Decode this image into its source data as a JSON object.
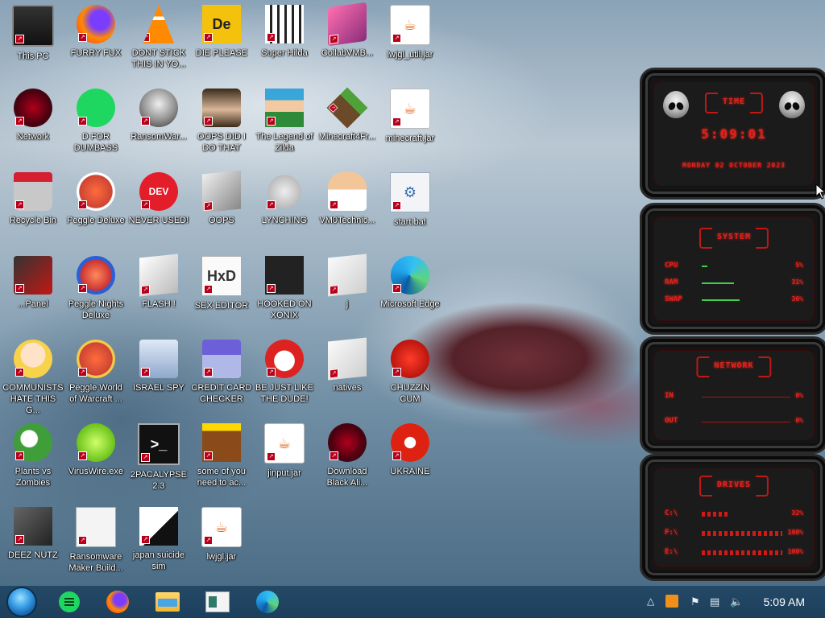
{
  "desktop": {
    "icons": [
      {
        "label": "This PC",
        "icon": "computer-icon"
      },
      {
        "label": "FURRY FUX",
        "icon": "firefox-icon"
      },
      {
        "label": "DONT STICK THIS IN YO...",
        "icon": "vlc-cone-icon"
      },
      {
        "label": "DIE PLEASE",
        "icon": "die-logo-icon"
      },
      {
        "label": "Super Hilda",
        "icon": "pixel-art-icon"
      },
      {
        "label": "CollabVMB...",
        "icon": "collabvm-icon"
      },
      {
        "label": "lwjgl_util.jar",
        "icon": "java-jar-icon"
      },
      {
        "label": "Network",
        "icon": "network-icon"
      },
      {
        "label": "D FOR DUMBASS",
        "icon": "green-chat-icon"
      },
      {
        "label": "RansomWar...",
        "icon": "skull-icon"
      },
      {
        "label": "OOPS DID I DO THAT",
        "icon": "portrait-icon"
      },
      {
        "label": "The Legend of Zilda",
        "icon": "pixel-hero-icon"
      },
      {
        "label": "Minecraft4Fr...",
        "icon": "grass-block-icon"
      },
      {
        "label": "minecraft.jar",
        "icon": "java-jar-icon"
      },
      {
        "label": "Recycle Bin",
        "icon": "recycle-bin-icon"
      },
      {
        "label": "Peggle Deluxe",
        "icon": "peggle-icon"
      },
      {
        "label": "NEVER USED!",
        "icon": "devcpp-icon"
      },
      {
        "label": "OOPS",
        "icon": "oops-box-icon"
      },
      {
        "label": "LYNCHING",
        "icon": "noose-icon"
      },
      {
        "label": "VM0Technic...",
        "icon": "doctor-icon"
      },
      {
        "label": "start.bat",
        "icon": "batch-file-icon"
      },
      {
        "label": "...Panel",
        "icon": "control-panel-icon"
      },
      {
        "label": "Peggle Nights Deluxe",
        "icon": "peggle-nights-icon"
      },
      {
        "label": "FLASH !",
        "icon": "flash-icon"
      },
      {
        "label": "SEX EDITOR",
        "icon": "hxd-icon"
      },
      {
        "label": "HOOKED ON XONIX",
        "icon": "xonix-icon"
      },
      {
        "label": "j",
        "icon": "file-icon"
      },
      {
        "label": "Microsoft Edge",
        "icon": "edge-icon"
      },
      {
        "label": "COMMUNISTS HATE THIS G...",
        "icon": "cartoon-girl-icon"
      },
      {
        "label": "Peggle World of Warcraft ...",
        "icon": "peggle-wow-icon"
      },
      {
        "label": "ISRAEL SPY",
        "icon": "spy-icon"
      },
      {
        "label": "CREDIT CARD CHECKER",
        "icon": "credit-card-icon"
      },
      {
        "label": "BE JUST LIKE THE DUDE!",
        "icon": "santa-icon"
      },
      {
        "label": "natives",
        "icon": "folder-file-icon"
      },
      {
        "label": "CHUZZIN CUM",
        "icon": "chuzzle-icon"
      },
      {
        "label": "Plants vs Zombies",
        "icon": "plant-icon"
      },
      {
        "label": "VirusWire.exe",
        "icon": "lime-icon"
      },
      {
        "label": "2PACALYPSE 2.3",
        "icon": "terminal-icon"
      },
      {
        "label": "some of you need to ac...",
        "icon": "dog-icon"
      },
      {
        "label": "jinput.jar",
        "icon": "java-jar-icon"
      },
      {
        "label": "Download Black Ali...",
        "icon": "alienware-icon"
      },
      {
        "label": "UKRAINE",
        "icon": "radiation-icon"
      },
      {
        "label": "DEEZ NUTZ",
        "icon": "stack-icon"
      },
      {
        "label": "Ransomware Maker Build...",
        "icon": "window-app-icon"
      },
      {
        "label": "japan suicide sim",
        "icon": "anime-sim-icon"
      },
      {
        "label": "lwjgl.jar",
        "icon": "java-jar-icon"
      }
    ]
  },
  "widget": {
    "time": {
      "header": "TIME",
      "clock": "5:09:01",
      "date": "MONDAY 02 OCTOBER 2023"
    },
    "system": {
      "header": "SYSTEM",
      "rows": [
        {
          "name": "CPU",
          "value": "5%",
          "level": 0.05
        },
        {
          "name": "RAM",
          "value": "31%",
          "level": 0.31
        },
        {
          "name": "SWAP",
          "value": "36%",
          "level": 0.36
        }
      ]
    },
    "network": {
      "header": "NETWORK",
      "rows": [
        {
          "name": "IN",
          "value": "0%"
        },
        {
          "name": "OUT",
          "value": "0%"
        }
      ]
    },
    "drives": {
      "header": "DRIVES",
      "rows": [
        {
          "name": "C:\\",
          "value": "32%",
          "level": 0.32
        },
        {
          "name": "F:\\",
          "value": "100%",
          "level": 1.0
        },
        {
          "name": "E:\\",
          "value": "100%",
          "level": 1.0
        }
      ]
    }
  },
  "taskbar": {
    "start": "start-orb-icon",
    "apps": [
      "green-chat-icon",
      "firefox-icon",
      "file-explorer-icon",
      "window-app-icon",
      "edge-icon"
    ],
    "tray": [
      "chevron-up-icon",
      "orange-app-icon",
      "flag-icon",
      "network-icon",
      "volume-icon"
    ],
    "clock": "5:09 AM"
  },
  "colors": {
    "widget_red": "#e2201c",
    "taskbar": "#1f4562"
  }
}
